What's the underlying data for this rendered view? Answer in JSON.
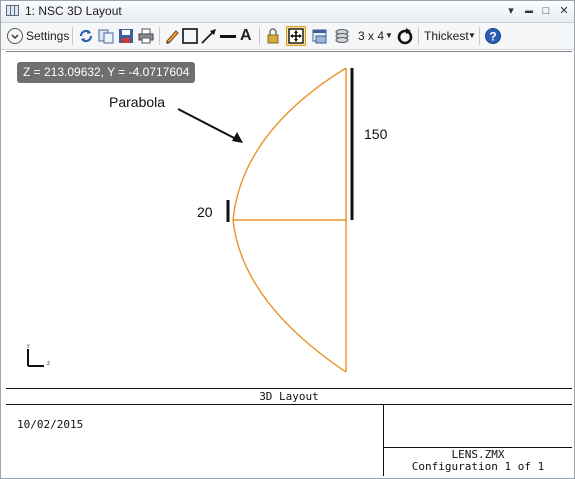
{
  "window": {
    "title": "1: NSC 3D Layout",
    "controls": {
      "pin": "▾",
      "maximize": "□",
      "close": "✕"
    }
  },
  "toolbar": {
    "settings_label": "Settings",
    "grid_label": "3 x 4",
    "thickness_label": "Thickest",
    "icons": [
      "chevron-circle-icon",
      "refresh-icon",
      "copy-icon",
      "save-icon",
      "print-icon",
      "pencil-icon",
      "rectangle-icon",
      "line-arrow-icon",
      "line-icon",
      "text-icon",
      "lock-icon",
      "fit-view-icon",
      "window-icon",
      "layers-icon",
      "rotate-icon",
      "help-icon"
    ],
    "accent_color": "#2b5fb3"
  },
  "plot": {
    "coordinate_readout": "Z = 213.09632, Y = -4.0717604",
    "annotation_parabola": "Parabola",
    "dimension_large": "150",
    "dimension_small": "20",
    "axis_z_label": "z",
    "axis_y_label": "y",
    "curve_color": "#e8942a"
  },
  "footer": {
    "title": "3D Layout",
    "date": "10/02/2015",
    "filename": "LENS.ZMX",
    "configuration": "Configuration 1 of 1"
  }
}
